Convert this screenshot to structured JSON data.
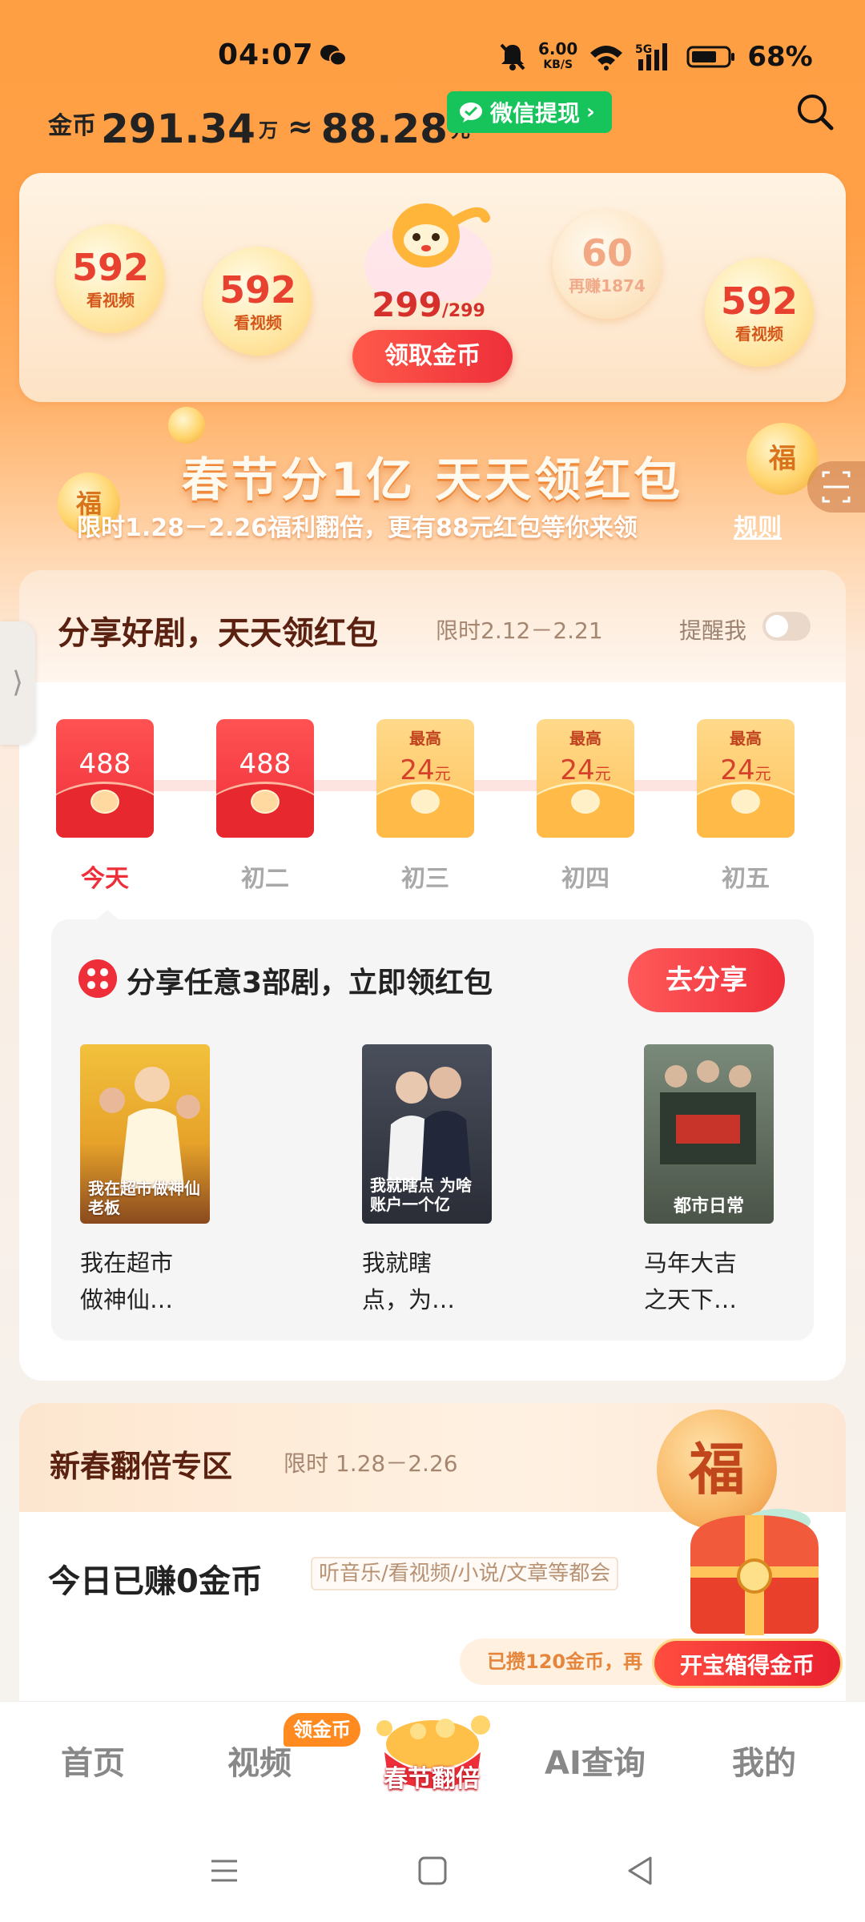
{
  "status_bar": {
    "time": "04:07",
    "speed_value": "6.00",
    "speed_unit": "KB/S",
    "network": "5G",
    "battery": "68%"
  },
  "header": {
    "coin_label": "金币",
    "coin_value": "291.34",
    "coin_unit": "万",
    "approx": "≈",
    "cash_value": "88.28",
    "cash_unit": "元",
    "withdraw_label": "微信提现"
  },
  "bubbles": [
    {
      "num": "592",
      "label": "看视频"
    },
    {
      "num": "592",
      "label": "看视频"
    },
    {
      "num": "60",
      "label": "再赚1874"
    },
    {
      "num": "592",
      "label": "看视频"
    }
  ],
  "claim": {
    "count": "299",
    "total": "/299",
    "button": "领取金币"
  },
  "banner": {
    "title": "春节分1亿 天天领红包",
    "subtitle": "限时1.28－2.26福利翻倍，更有88元红包等你来领",
    "rule": "规则",
    "coin_char": "福"
  },
  "share_section": {
    "title": "分享好剧，天天领红包",
    "limit": "限时2.12－2.21",
    "remind": "提醒我",
    "days": [
      {
        "label": "今天",
        "amount": "488",
        "type": "red",
        "active": true
      },
      {
        "label": "初二",
        "amount": "488",
        "type": "red",
        "active": false
      },
      {
        "label": "初三",
        "top": "最高",
        "amount": "24",
        "unit": "元",
        "type": "gold"
      },
      {
        "label": "初四",
        "top": "最高",
        "amount": "24",
        "unit": "元",
        "type": "gold"
      },
      {
        "label": "初五",
        "top": "最高",
        "amount": "24",
        "unit": "元",
        "type": "gold"
      }
    ],
    "task_text": "分享任意3部剧，立即领红包",
    "go_share": "去分享",
    "dramas": [
      {
        "title_line1": "我在超市",
        "title_line2": "做神仙…",
        "poster_text": "我在超市做神仙老板"
      },
      {
        "title_line1": "我就瞎",
        "title_line2": "点，为…",
        "poster_text": "我就瞎点 为啥账户一个亿"
      },
      {
        "title_line1": "马年大吉",
        "title_line2": "之天下…",
        "poster_text": "都市日常"
      }
    ]
  },
  "spring_section": {
    "title": "新春翻倍专区",
    "limit": "限时 1.28－2.26",
    "earned": "今日已赚0金币",
    "earned_tag": "听音乐/看视频/小说/文章等都会",
    "saved": "已攒120金币，再",
    "chest_button": "开宝箱得金币",
    "fu_char": "福"
  },
  "bottom_nav": {
    "items": [
      "首页",
      "视频",
      "春节翻倍",
      "AI查询",
      "我的"
    ],
    "badge": "领金币"
  },
  "colors": {
    "accent_orange": "#ff9f43",
    "red": "#ee2f3a",
    "wechat_green": "#17c45c"
  }
}
